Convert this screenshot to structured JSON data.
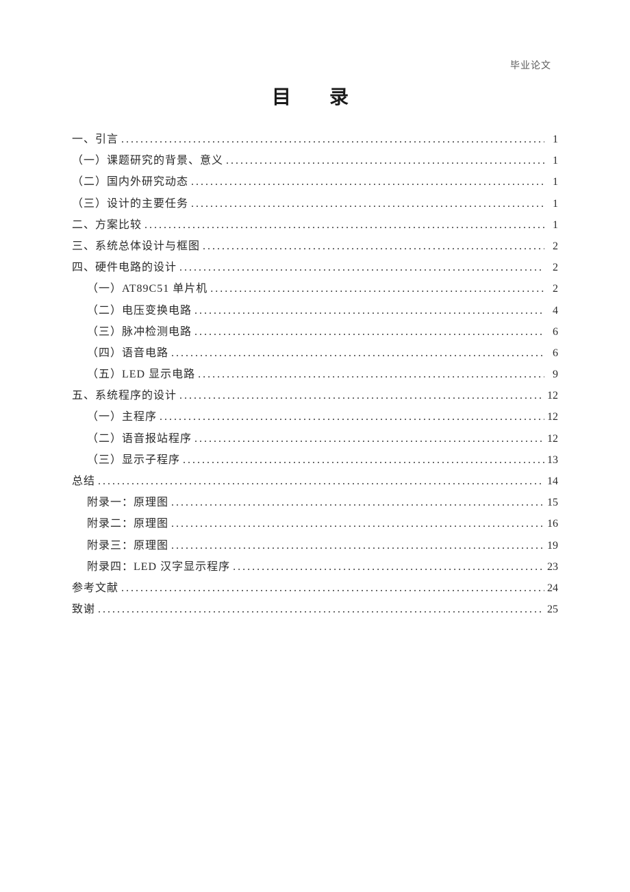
{
  "header": "毕业论文",
  "title": "目　录",
  "dots": "................................................................................................................................",
  "toc": [
    {
      "label": "一、引言",
      "page": "1",
      "indent": 0
    },
    {
      "label": "（一）课题研究的背景、意义",
      "page": "1",
      "indent": 0
    },
    {
      "label": "（二）国内外研究动态",
      "page": "1",
      "indent": 0
    },
    {
      "label": "（三）设计的主要任务",
      "page": "1",
      "indent": 0
    },
    {
      "label": "二、方案比较",
      "page": "1",
      "indent": 0
    },
    {
      "label": "三、系统总体设计与框图",
      "page": "2",
      "indent": 0
    },
    {
      "label": "四、硬件电路的设计",
      "page": "2",
      "indent": 0
    },
    {
      "label": "（一）AT89C51 单片机",
      "page": "2",
      "indent": 1
    },
    {
      "label": "（二）电压变换电路",
      "page": "4",
      "indent": 1
    },
    {
      "label": "（三）脉冲检测电路",
      "page": "6",
      "indent": 1
    },
    {
      "label": "（四）语音电路",
      "page": "6",
      "indent": 1
    },
    {
      "label": "（五）LED 显示电路",
      "page": "9",
      "indent": 1
    },
    {
      "label": "五、系统程序的设计",
      "page": "12",
      "indent": 0
    },
    {
      "label": "（一）主程序",
      "page": "12",
      "indent": 1
    },
    {
      "label": "（二）语音报站程序",
      "page": "12",
      "indent": 1
    },
    {
      "label": "（三）显示子程序",
      "page": "13",
      "indent": 1
    },
    {
      "label": "总结",
      "page": "14",
      "indent": 0
    },
    {
      "label": "附录一：原理图",
      "page": "15",
      "indent": 1
    },
    {
      "label": "附录二：原理图",
      "page": "16",
      "indent": 1
    },
    {
      "label": "附录三：原理图",
      "page": "19",
      "indent": 1
    },
    {
      "label": "附录四：LED 汉字显示程序",
      "page": "23",
      "indent": 1
    },
    {
      "label": "参考文献",
      "page": "24",
      "indent": 0
    },
    {
      "label": "致谢",
      "page": "25",
      "indent": 0
    }
  ]
}
